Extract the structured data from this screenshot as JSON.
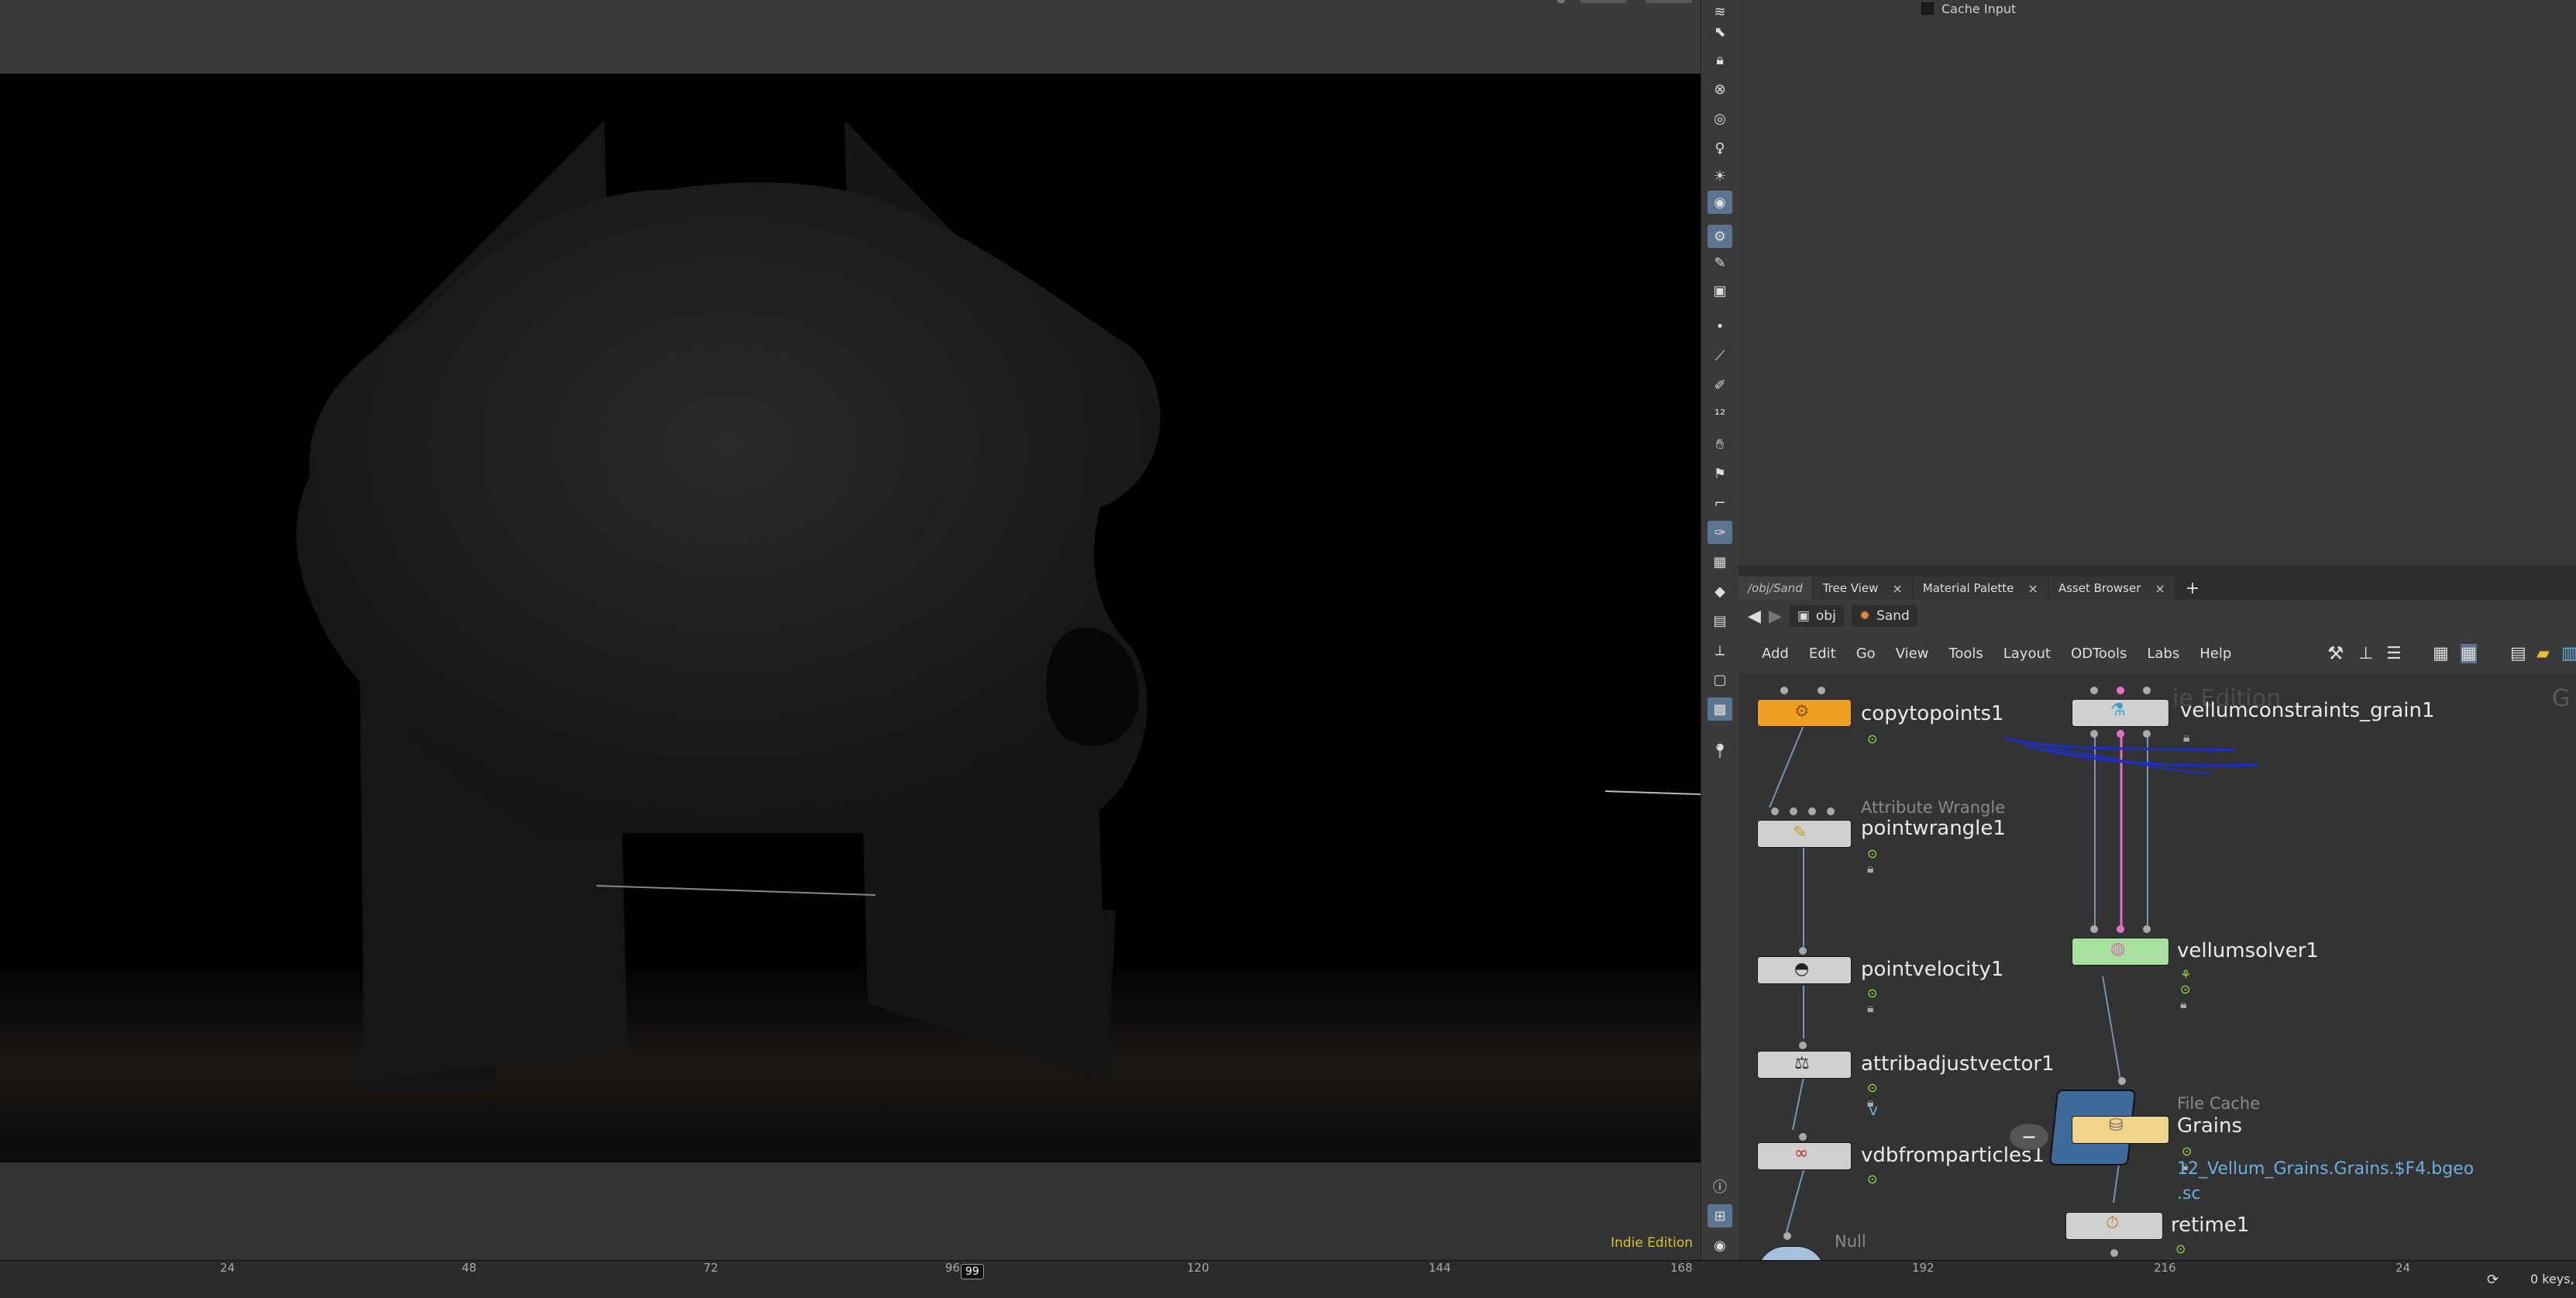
{
  "params": {
    "cache_input_label": "Cache Input"
  },
  "viewport": {
    "edition_label": "Indie Edition"
  },
  "tabs": [
    {
      "label": "/obj/Sand"
    },
    {
      "label": "Tree View"
    },
    {
      "label": "Material Palette"
    },
    {
      "label": "Asset Browser"
    }
  ],
  "pathbar": {
    "obj": "obj",
    "sand": "Sand"
  },
  "menu": [
    "Add",
    "Edit",
    "Go",
    "View",
    "Tools",
    "Layout",
    "ODTools",
    "Labs",
    "Help"
  ],
  "nodes": {
    "copytopoints": {
      "name": "copytopoints1"
    },
    "pointwrangle": {
      "type": "Attribute Wrangle",
      "name": "pointwrangle1"
    },
    "pointvelocity": {
      "name": "pointvelocity1"
    },
    "attribadjust": {
      "name": "attribadjustvector1",
      "note": "v"
    },
    "vdbfromparticles": {
      "name": "vdbfromparticles1"
    },
    "null": {
      "type": "Null"
    },
    "vellumconstraints": {
      "name": "vellumconstraints_grain1",
      "watermark": "ie Edition"
    },
    "vellumsolver": {
      "name": "vellumsolver1"
    },
    "filecache": {
      "type": "File Cache",
      "name": "Grains",
      "path1": "12_Vellum_Grains.Grains.$F4.bgeo",
      "path2": ".sc"
    },
    "retime": {
      "name": "retime1"
    },
    "edge_label": "G"
  },
  "timeline": {
    "ticks": [
      "24",
      "48",
      "72",
      "96",
      "120",
      "144",
      "168",
      "192",
      "216",
      "24"
    ],
    "current_frame": "99",
    "keys_label": "0 keys,"
  },
  "colors": {
    "copytopoints": "#f0a020",
    "vellumsolver": "#a8e0a0",
    "filecache": "#f0d48a",
    "node_default": "#d0d0d0",
    "edition": "#d8c23a",
    "wire_pink": "#e070c0",
    "annotation_blue": "#1a2fd0"
  }
}
